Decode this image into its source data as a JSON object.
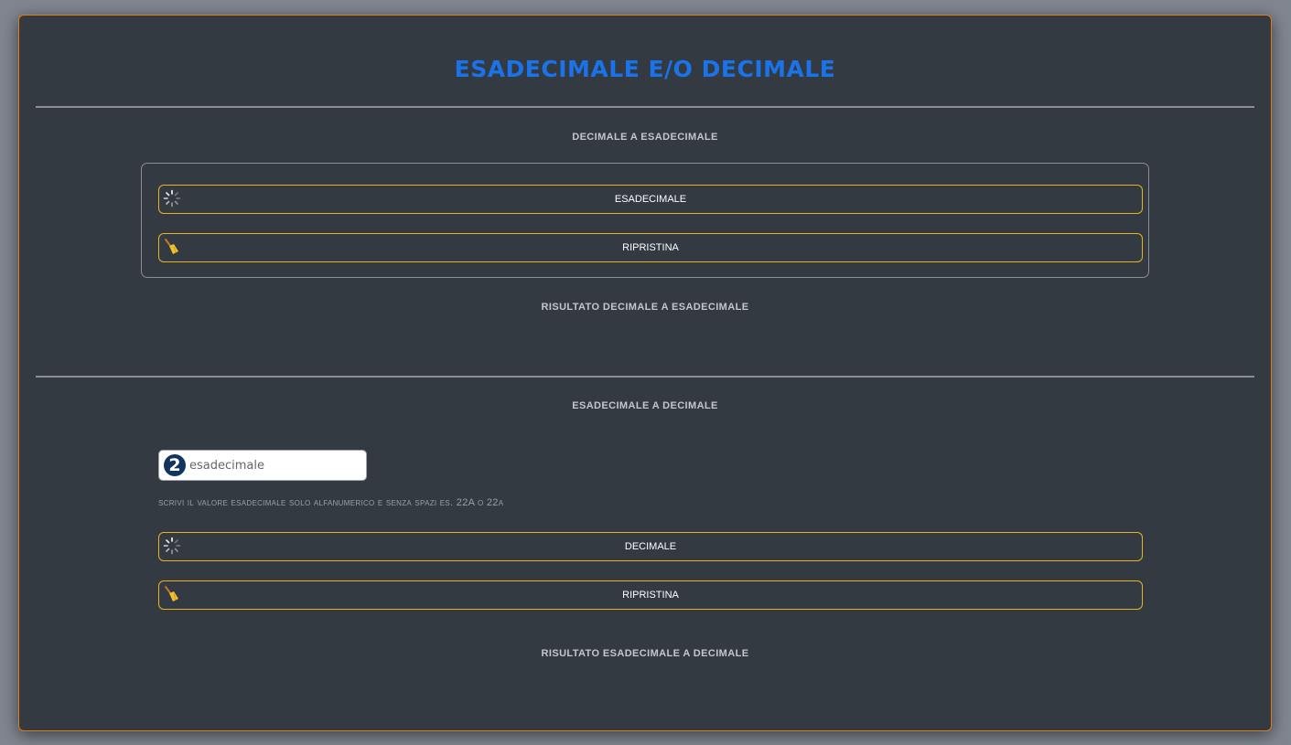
{
  "title": "ESADECIMALE E/O DECIMALE",
  "section1": {
    "label": "DECIMALE A ESADECIMALE",
    "convert_button": "ESADECIMALE",
    "convert_icon": "spinner-icon",
    "reset_button": "RIPRISTINA",
    "reset_icon": "broom-icon",
    "result_label": "RISULTATO DECIMALE A ESADECIMALE"
  },
  "section2": {
    "label": "ESADECIMALE A DECIMALE",
    "input_badge": "2",
    "input_placeholder": "esadecimale",
    "input_value": "",
    "hint": "scrivi il valore esadecimale solo alfanumerico e senza spazi es. 22A o 22a",
    "convert_button": "DECIMALE",
    "convert_icon": "spinner-icon",
    "reset_button": "RIPRISTINA",
    "reset_icon": "broom-icon",
    "result_label": "RISULTATO ESADECIMALE A DECIMALE"
  },
  "colors": {
    "title": "#1a73e8",
    "card_border": "#e07b1a",
    "button_border": "#e6b422",
    "background": "#343a42"
  }
}
